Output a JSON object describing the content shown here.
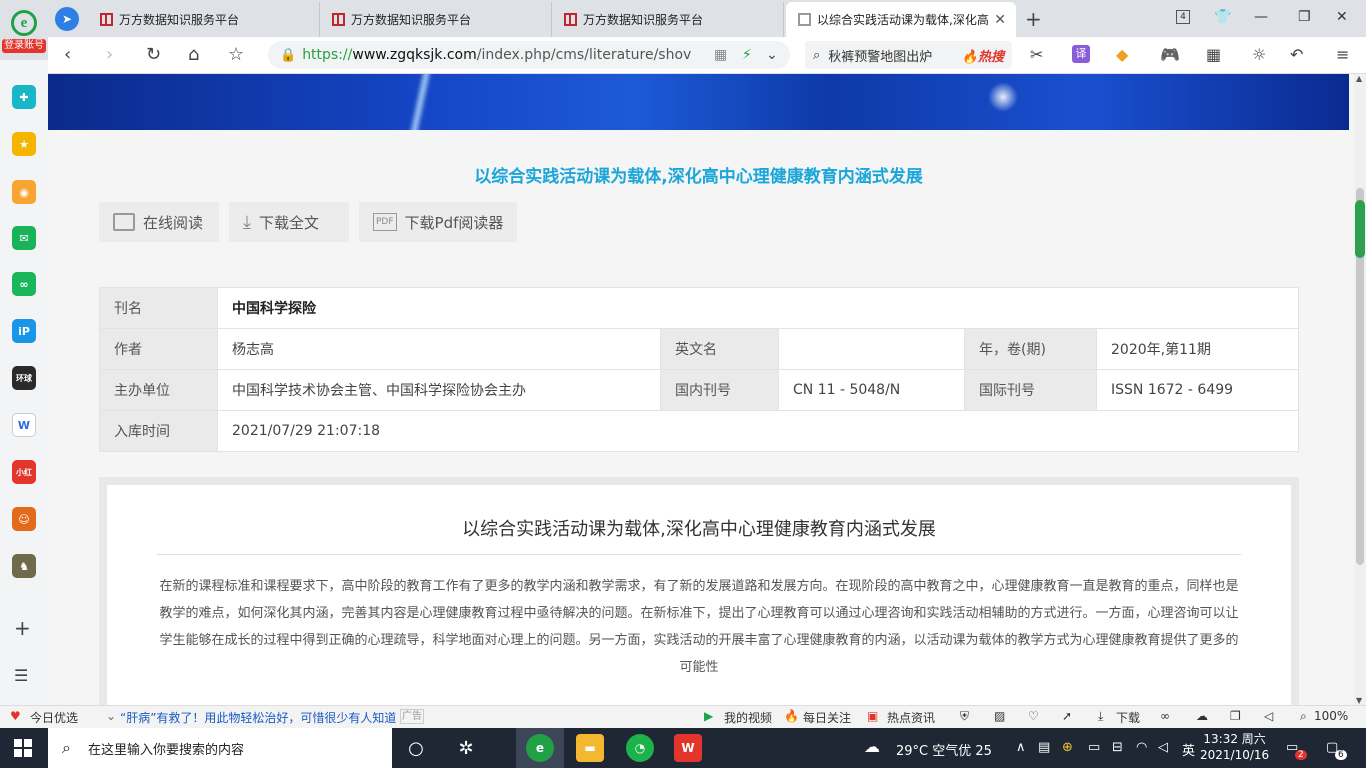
{
  "browser": {
    "login_label": "登录账号",
    "tabs": [
      {
        "title": "万方数据知识服务平台"
      },
      {
        "title": "万方数据知识服务平台"
      },
      {
        "title": "万方数据知识服务平台"
      },
      {
        "title": "以综合实践活动课为载体,深化高"
      }
    ],
    "tab_count": "4",
    "url_prefix": "https://",
    "url_host": "www.zgqksjk.com",
    "url_path": "/index.php/cms/literature/shov",
    "search_text": "秋裤预警地图出炉",
    "hot_label": "🔥热搜"
  },
  "page": {
    "article_title": "以综合实践活动课为载体,深化高中心理健康教育内涵式发展",
    "actions": {
      "read_online": "在线阅读",
      "download_full": "下载全文",
      "download_pdf_reader": "下载Pdf阅读器"
    },
    "meta": {
      "journal_label": "刊名",
      "journal_value": "中国科学探险",
      "author_label": "作者",
      "author_value": "杨志高",
      "english_name_label": "英文名",
      "english_name_value": "",
      "year_vol_label": "年，卷(期)",
      "year_vol_value": "2020年,第11期",
      "sponsor_label": "主办单位",
      "sponsor_value": "中国科学技术协会主管、中国科学探险协会主办",
      "cn_label": "国内刊号",
      "cn_value": "CN 11 - 5048/N",
      "issn_label": "国际刊号",
      "issn_value": "ISSN 1672 - 6499",
      "stored_label": "入库时间",
      "stored_value": "2021/07/29 21:07:18"
    },
    "abstract": {
      "title": "以综合实践活动课为载体,深化高中心理健康教育内涵式发展",
      "text": "在新的课程标准和课程要求下，高中阶段的教育工作有了更多的教学内涵和教学需求，有了新的发展道路和发展方向。在现阶段的高中教育之中，心理健康教育一直是教育的重点，同样也是教学的难点，如何深化其内涵，完善其内容是心理健康教育过程中亟待解决的问题。在新标准下，提出了心理教育可以通过心理咨询和实践活动相辅助的方式进行。一方面，心理咨询可以让学生能够在成长的过程中得到正确的心理疏导，科学地面对心理上的问题。另一方面，实践活动的开展丰富了心理健康教育的内涵，以活动课为载体的教学方式为心理健康教育提供了更多的可能性"
    }
  },
  "statusbar": {
    "today_picks": "今日优选",
    "news_ticker": "“肝病”有救了！用此物轻松治好，可惜很少有人知道",
    "ad_tag": "广告",
    "my_video": "我的视频",
    "daily_focus": "每日关注",
    "hot_news": "热点资讯",
    "download": "下载",
    "zoom": "100%"
  },
  "taskbar": {
    "search_placeholder": "在这里输入你要搜索的内容",
    "weather": "29°C  空气优 25",
    "ime": "英",
    "time": "13:32 周六",
    "date": "2021/10/16",
    "notif_count": "6",
    "badge_count": "2"
  }
}
